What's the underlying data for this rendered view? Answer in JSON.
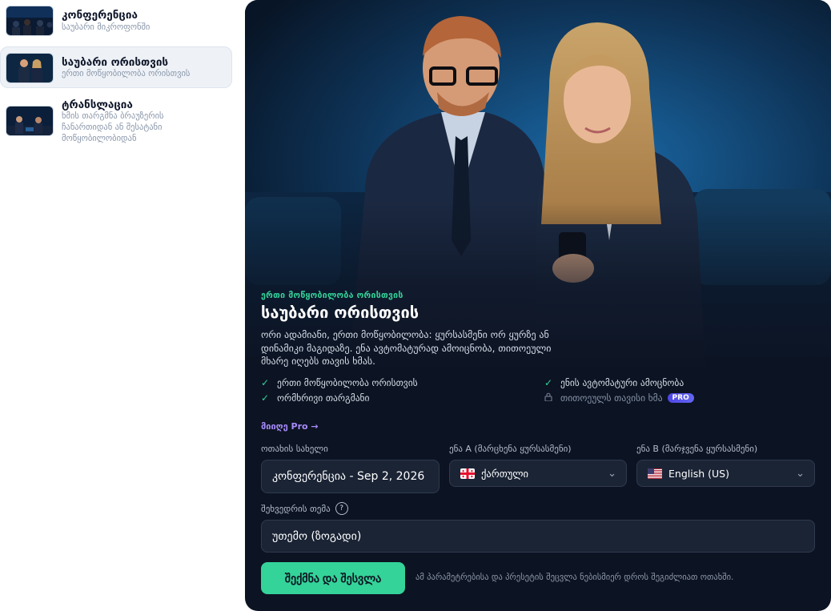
{
  "modes": [
    {
      "title": "კონფერენცია",
      "subtitle": "საუბარი მიკროფონში"
    },
    {
      "title": "საუბარი ორისთვის",
      "subtitle": "ერთი მოწყობილობა ორისთვის"
    },
    {
      "title": "ტრანსლაცია",
      "subtitle": "ხმის თარგმნა ბრაუზერის ჩანართიდან ან შესატანი მოწყობილობიდან"
    }
  ],
  "hero": {
    "kicker": "ერთი მოწყობილობა ორისთვის",
    "title": "საუბარი ორისთვის",
    "description": "ორი ადამიანი, ერთი მოწყობილობა: ყურსასმენი ორ ყურზე ან დინამიკი მაგიდაზე. ენა ავტომატურად ამოიცნობა, თითოეული მხარე იღებს თავის ხმას."
  },
  "features": [
    {
      "label": "ერთი მოწყობილობა ორისთვის",
      "icon": "check-icon",
      "locked": false
    },
    {
      "label": "ენის ავტომატური ამოცნობა",
      "icon": "check-icon",
      "locked": false
    },
    {
      "label": "ორმხრივი თარგმანი",
      "icon": "check-icon",
      "locked": false
    },
    {
      "label": "თითოეულს თავისი ხმა",
      "icon": "lock-icon",
      "locked": true,
      "badge": "PRO"
    }
  ],
  "pro_link": "მიიღე Pro →",
  "form": {
    "room_label": "ოთახის სახელი",
    "room_value": "კონფერენცია - Sep 2, 2026",
    "lang_a_label": "ენა A (მარცხენა ყურსასმენი)",
    "lang_a_value": "ქართული",
    "lang_b_label": "ენა B (მარჯვენა ყურსასმენი)",
    "lang_b_value": "English (US)",
    "topic_label": "შეხვედრის თემა",
    "topic_help": "?",
    "topic_value": "უთემო (ზოგადი)"
  },
  "create_button": "შექმნა და შესვლა",
  "footnote": "ამ პარამეტრებისა და პრესეტის შეცვლა ნებისმიერ დროს შეგიძლიათ ოთახში.",
  "colors": {
    "accent": "#34d399",
    "pro_link": "#a78bfa",
    "panel_bg": "#0c1322"
  }
}
